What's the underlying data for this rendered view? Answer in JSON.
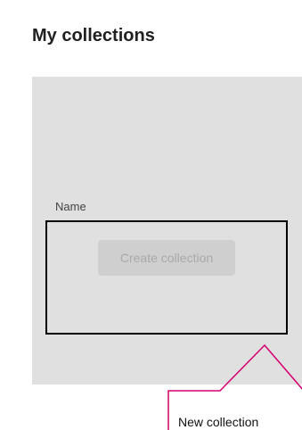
{
  "header": {
    "title": "My collections"
  },
  "form": {
    "name_label": "Name",
    "create_button_label": "Create collection",
    "create_button_enabled": false
  },
  "callout": {
    "text": "New collection",
    "border_color": "#d6006e"
  },
  "colors": {
    "panel_background": "#e0e0e0",
    "button_background": "#cfcfcf",
    "button_text": "#a9a9a9",
    "highlight_border": "#000000",
    "callout_border": "#d6006e"
  }
}
